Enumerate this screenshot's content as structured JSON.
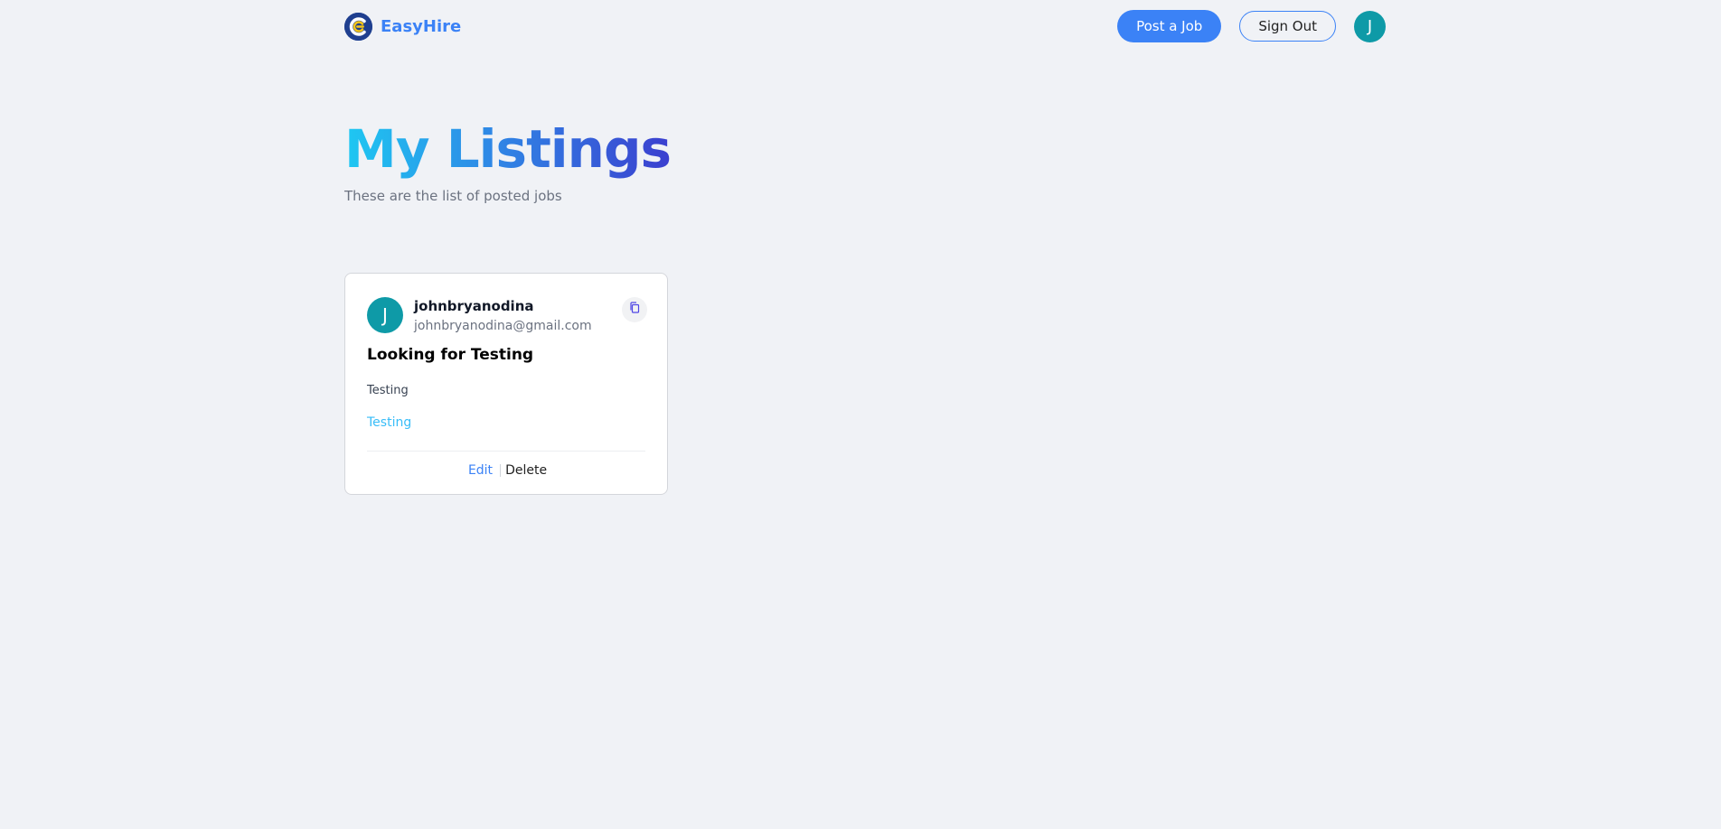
{
  "header": {
    "brand_name": "EasyHire",
    "post_job_label": "Post a Job",
    "sign_out_label": "Sign Out",
    "user_initial": "J"
  },
  "main": {
    "title": "My Listings",
    "subtitle": "These are the list of posted jobs"
  },
  "listings": [
    {
      "avatar_initial": "J",
      "username": "johnbryanodina",
      "email": "johnbryanodina@gmail.com",
      "title": "Looking for Testing",
      "description": "Testing",
      "tag": "Testing",
      "edit_label": "Edit",
      "delete_label": "Delete",
      "copy_icon": "copy-icon"
    }
  ],
  "colors": {
    "background": "#f0f2f6",
    "primary": "#3b82f6",
    "avatar": "#0e9aa7",
    "tag": "#38bdf8",
    "title_gradient": [
      "#1ec8f2",
      "#2f88e6",
      "#3b3fcf"
    ]
  },
  "icons": {
    "logo": "easyhire-logo-icon",
    "copy": "copy-icon"
  }
}
